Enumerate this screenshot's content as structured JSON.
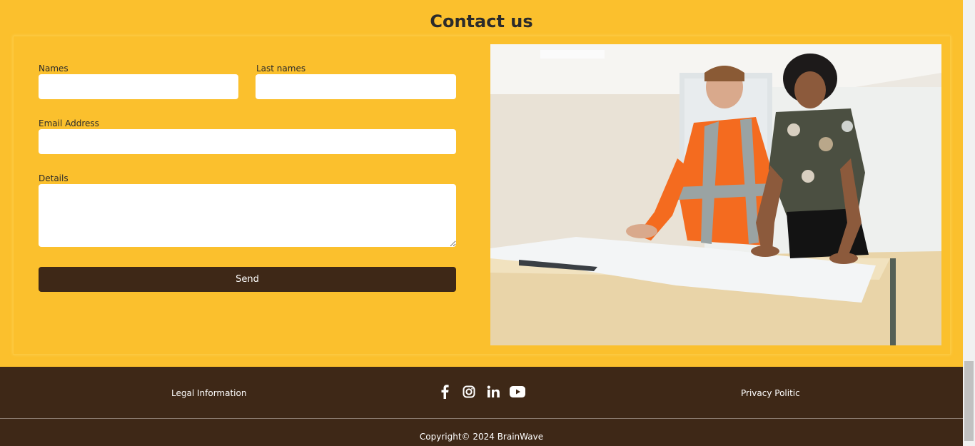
{
  "contact": {
    "title": "Contact us",
    "form": {
      "names_label": "Names",
      "names_value": "",
      "last_names_label": "Last names",
      "last_names_value": "",
      "email_label": "Email Address",
      "email_value": "",
      "details_label": "Details",
      "details_value": "",
      "send_label": "Send"
    },
    "photo_alt": "Two people reviewing blueprints on a table"
  },
  "footer": {
    "legal_label": "Legal Information",
    "privacy_label": "Privacy Politic",
    "social_icons": [
      "facebook-icon",
      "instagram-icon",
      "linkedin-icon",
      "youtube-icon"
    ],
    "copyright": "Copyright© 2024 BrainWave"
  },
  "colors": {
    "page_bg": "#fbc02d",
    "accent_dark": "#3e2817",
    "field_bg": "#ffffff"
  }
}
